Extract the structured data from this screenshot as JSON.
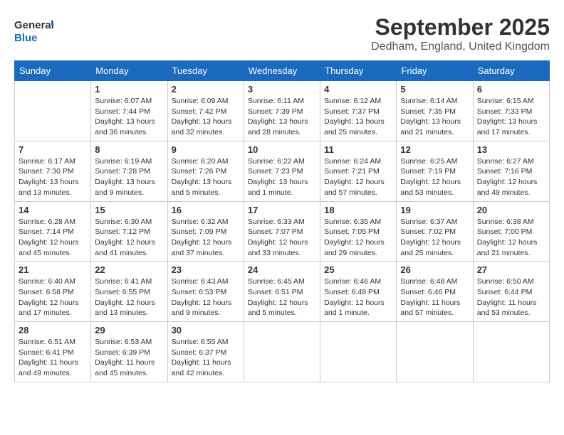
{
  "logo": {
    "general": "General",
    "blue": "Blue"
  },
  "title": "September 2025",
  "location": "Dedham, England, United Kingdom",
  "days_header": [
    "Sunday",
    "Monday",
    "Tuesday",
    "Wednesday",
    "Thursday",
    "Friday",
    "Saturday"
  ],
  "weeks": [
    [
      {
        "day": "",
        "content": ""
      },
      {
        "day": "1",
        "content": "Sunrise: 6:07 AM\nSunset: 7:44 PM\nDaylight: 13 hours\nand 36 minutes."
      },
      {
        "day": "2",
        "content": "Sunrise: 6:09 AM\nSunset: 7:42 PM\nDaylight: 13 hours\nand 32 minutes."
      },
      {
        "day": "3",
        "content": "Sunrise: 6:11 AM\nSunset: 7:39 PM\nDaylight: 13 hours\nand 28 minutes."
      },
      {
        "day": "4",
        "content": "Sunrise: 6:12 AM\nSunset: 7:37 PM\nDaylight: 13 hours\nand 25 minutes."
      },
      {
        "day": "5",
        "content": "Sunrise: 6:14 AM\nSunset: 7:35 PM\nDaylight: 13 hours\nand 21 minutes."
      },
      {
        "day": "6",
        "content": "Sunrise: 6:15 AM\nSunset: 7:33 PM\nDaylight: 13 hours\nand 17 minutes."
      }
    ],
    [
      {
        "day": "7",
        "content": "Sunrise: 6:17 AM\nSunset: 7:30 PM\nDaylight: 13 hours\nand 13 minutes."
      },
      {
        "day": "8",
        "content": "Sunrise: 6:19 AM\nSunset: 7:28 PM\nDaylight: 13 hours\nand 9 minutes."
      },
      {
        "day": "9",
        "content": "Sunrise: 6:20 AM\nSunset: 7:26 PM\nDaylight: 13 hours\nand 5 minutes."
      },
      {
        "day": "10",
        "content": "Sunrise: 6:22 AM\nSunset: 7:23 PM\nDaylight: 13 hours\nand 1 minute."
      },
      {
        "day": "11",
        "content": "Sunrise: 6:24 AM\nSunset: 7:21 PM\nDaylight: 12 hours\nand 57 minutes."
      },
      {
        "day": "12",
        "content": "Sunrise: 6:25 AM\nSunset: 7:19 PM\nDaylight: 12 hours\nand 53 minutes."
      },
      {
        "day": "13",
        "content": "Sunrise: 6:27 AM\nSunset: 7:16 PM\nDaylight: 12 hours\nand 49 minutes."
      }
    ],
    [
      {
        "day": "14",
        "content": "Sunrise: 6:28 AM\nSunset: 7:14 PM\nDaylight: 12 hours\nand 45 minutes."
      },
      {
        "day": "15",
        "content": "Sunrise: 6:30 AM\nSunset: 7:12 PM\nDaylight: 12 hours\nand 41 minutes."
      },
      {
        "day": "16",
        "content": "Sunrise: 6:32 AM\nSunset: 7:09 PM\nDaylight: 12 hours\nand 37 minutes."
      },
      {
        "day": "17",
        "content": "Sunrise: 6:33 AM\nSunset: 7:07 PM\nDaylight: 12 hours\nand 33 minutes."
      },
      {
        "day": "18",
        "content": "Sunrise: 6:35 AM\nSunset: 7:05 PM\nDaylight: 12 hours\nand 29 minutes."
      },
      {
        "day": "19",
        "content": "Sunrise: 6:37 AM\nSunset: 7:02 PM\nDaylight: 12 hours\nand 25 minutes."
      },
      {
        "day": "20",
        "content": "Sunrise: 6:38 AM\nSunset: 7:00 PM\nDaylight: 12 hours\nand 21 minutes."
      }
    ],
    [
      {
        "day": "21",
        "content": "Sunrise: 6:40 AM\nSunset: 6:58 PM\nDaylight: 12 hours\nand 17 minutes."
      },
      {
        "day": "22",
        "content": "Sunrise: 6:41 AM\nSunset: 6:55 PM\nDaylight: 12 hours\nand 13 minutes."
      },
      {
        "day": "23",
        "content": "Sunrise: 6:43 AM\nSunset: 6:53 PM\nDaylight: 12 hours\nand 9 minutes."
      },
      {
        "day": "24",
        "content": "Sunrise: 6:45 AM\nSunset: 6:51 PM\nDaylight: 12 hours\nand 5 minutes."
      },
      {
        "day": "25",
        "content": "Sunrise: 6:46 AM\nSunset: 6:48 PM\nDaylight: 12 hours\nand 1 minute."
      },
      {
        "day": "26",
        "content": "Sunrise: 6:48 AM\nSunset: 6:46 PM\nDaylight: 11 hours\nand 57 minutes."
      },
      {
        "day": "27",
        "content": "Sunrise: 6:50 AM\nSunset: 6:44 PM\nDaylight: 11 hours\nand 53 minutes."
      }
    ],
    [
      {
        "day": "28",
        "content": "Sunrise: 6:51 AM\nSunset: 6:41 PM\nDaylight: 11 hours\nand 49 minutes."
      },
      {
        "day": "29",
        "content": "Sunrise: 6:53 AM\nSunset: 6:39 PM\nDaylight: 11 hours\nand 45 minutes."
      },
      {
        "day": "30",
        "content": "Sunrise: 6:55 AM\nSunset: 6:37 PM\nDaylight: 11 hours\nand 42 minutes."
      },
      {
        "day": "",
        "content": ""
      },
      {
        "day": "",
        "content": ""
      },
      {
        "day": "",
        "content": ""
      },
      {
        "day": "",
        "content": ""
      }
    ]
  ]
}
